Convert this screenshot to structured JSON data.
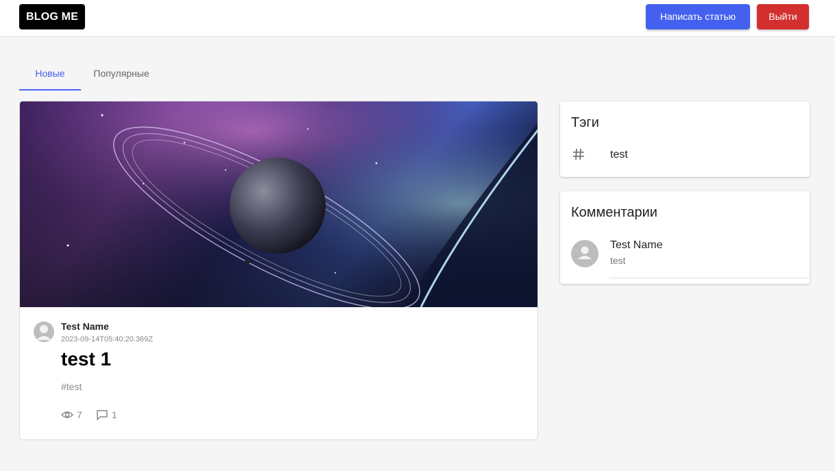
{
  "header": {
    "logo": "BLOG ME",
    "write_button": "Написать статью",
    "logout_button": "Выйти"
  },
  "tabs": [
    {
      "label": "Новые",
      "active": true
    },
    {
      "label": "Популярные",
      "active": false
    }
  ],
  "post": {
    "author": "Test Name",
    "date": "2023-09-14T05:40:20.369Z",
    "title": "test 1",
    "tag": "#test",
    "views": "7",
    "comments_count": "1",
    "image_icon": "space-planet-image"
  },
  "tags_block": {
    "title": "Тэги",
    "items": [
      {
        "label": "test",
        "icon": "hash-icon"
      }
    ]
  },
  "comments_block": {
    "title": "Комментарии",
    "items": [
      {
        "name": "Test Name",
        "text": "test"
      }
    ]
  },
  "colors": {
    "accent": "#4361ee",
    "danger": "#d32f2f",
    "background": "#f5f5f5"
  }
}
